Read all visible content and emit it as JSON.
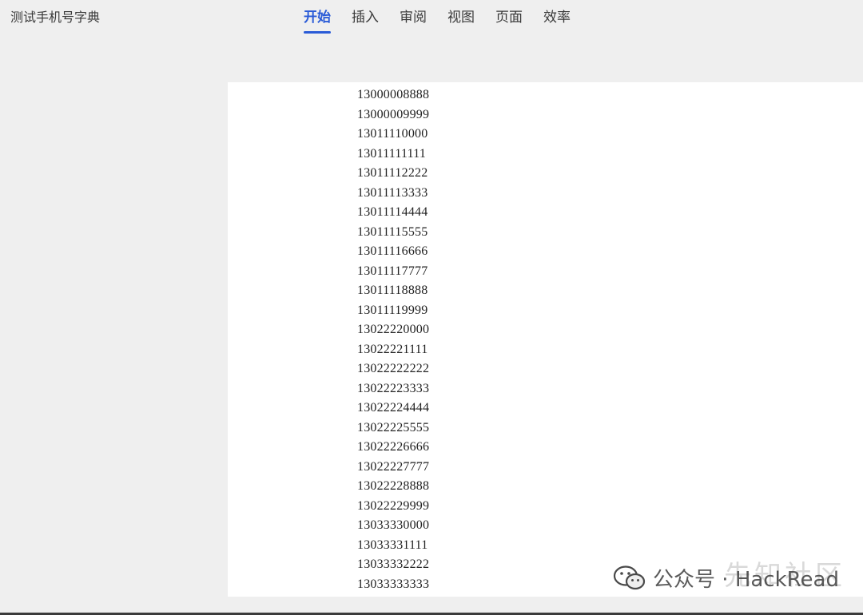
{
  "app": {
    "title": "测试手机号字典"
  },
  "menu": {
    "tabs": [
      {
        "label": "开始",
        "active": true
      },
      {
        "label": "插入",
        "active": false
      },
      {
        "label": "审阅",
        "active": false
      },
      {
        "label": "视图",
        "active": false
      },
      {
        "label": "页面",
        "active": false
      },
      {
        "label": "效率",
        "active": false
      }
    ]
  },
  "document": {
    "lines": [
      "13000008888",
      "13000009999",
      "13011110000",
      "13011111111",
      "13011112222",
      "13011113333",
      "13011114444",
      "13011115555",
      "13011116666",
      "13011117777",
      "13011118888",
      "13011119999",
      "13022220000",
      "13022221111",
      "13022222222",
      "13022223333",
      "13022224444",
      "13022225555",
      "13022226666",
      "13022227777",
      "13022228888",
      "13022229999",
      "13033330000",
      "13033331111",
      "13033332222",
      "13033333333"
    ]
  },
  "watermark": {
    "icon": "wechat-icon",
    "text": "公众号 · HackRead",
    "logo_text": "先知社区"
  },
  "colors": {
    "accent": "#2a5bd7",
    "background": "#efefef",
    "page": "#ffffff"
  }
}
